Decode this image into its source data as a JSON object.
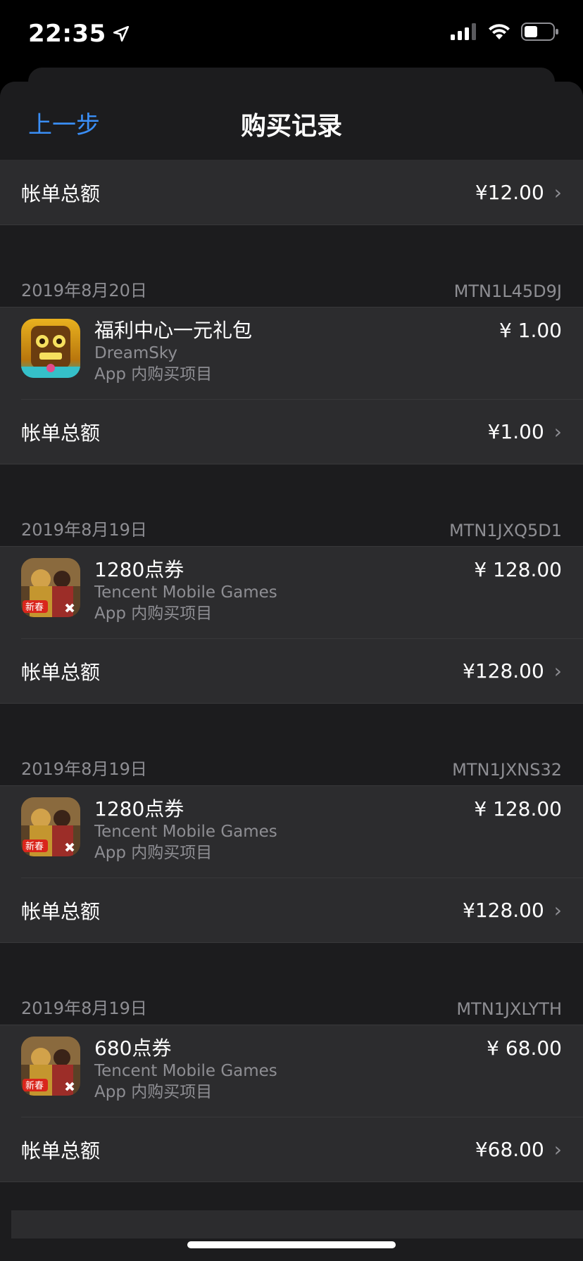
{
  "status_bar": {
    "time": "22:35"
  },
  "nav": {
    "back_label": "上一步",
    "title": "购买记录"
  },
  "partial_total": {
    "label": "帐单总额",
    "amount": "¥12.00"
  },
  "orders": [
    {
      "date": "2019年8月20日",
      "order_id": "MTN1L45D9J",
      "item": {
        "icon": "temple-run-app-icon",
        "title": "福利中心一元礼包",
        "developer": "DreamSky",
        "type": "App 内购买项目",
        "price": "¥ 1.00"
      },
      "total_label": "帐单总额",
      "total_amount": "¥1.00"
    },
    {
      "date": "2019年8月19日",
      "order_id": "MTN1JXQ5D1",
      "item": {
        "icon": "pubg-mobile-app-icon",
        "title": "1280点券",
        "developer": "Tencent Mobile Games",
        "type": "App 内购买项目",
        "price": "¥ 128.00"
      },
      "total_label": "帐单总额",
      "total_amount": "¥128.00"
    },
    {
      "date": "2019年8月19日",
      "order_id": "MTN1JXNS32",
      "item": {
        "icon": "pubg-mobile-app-icon",
        "title": "1280点券",
        "developer": "Tencent Mobile Games",
        "type": "App 内购买项目",
        "price": "¥ 128.00"
      },
      "total_label": "帐单总额",
      "total_amount": "¥128.00"
    },
    {
      "date": "2019年8月19日",
      "order_id": "MTN1JXLYTH",
      "item": {
        "icon": "pubg-mobile-app-icon",
        "title": "680点券",
        "developer": "Tencent Mobile Games",
        "type": "App 内购买项目",
        "price": "¥ 68.00"
      },
      "total_label": "帐单总额",
      "total_amount": "¥68.00"
    }
  ],
  "colors": {
    "accent": "#3a8ef6",
    "background": "#1c1c1e",
    "cell": "#2c2c2e",
    "secondary_text": "#8e8e93"
  }
}
